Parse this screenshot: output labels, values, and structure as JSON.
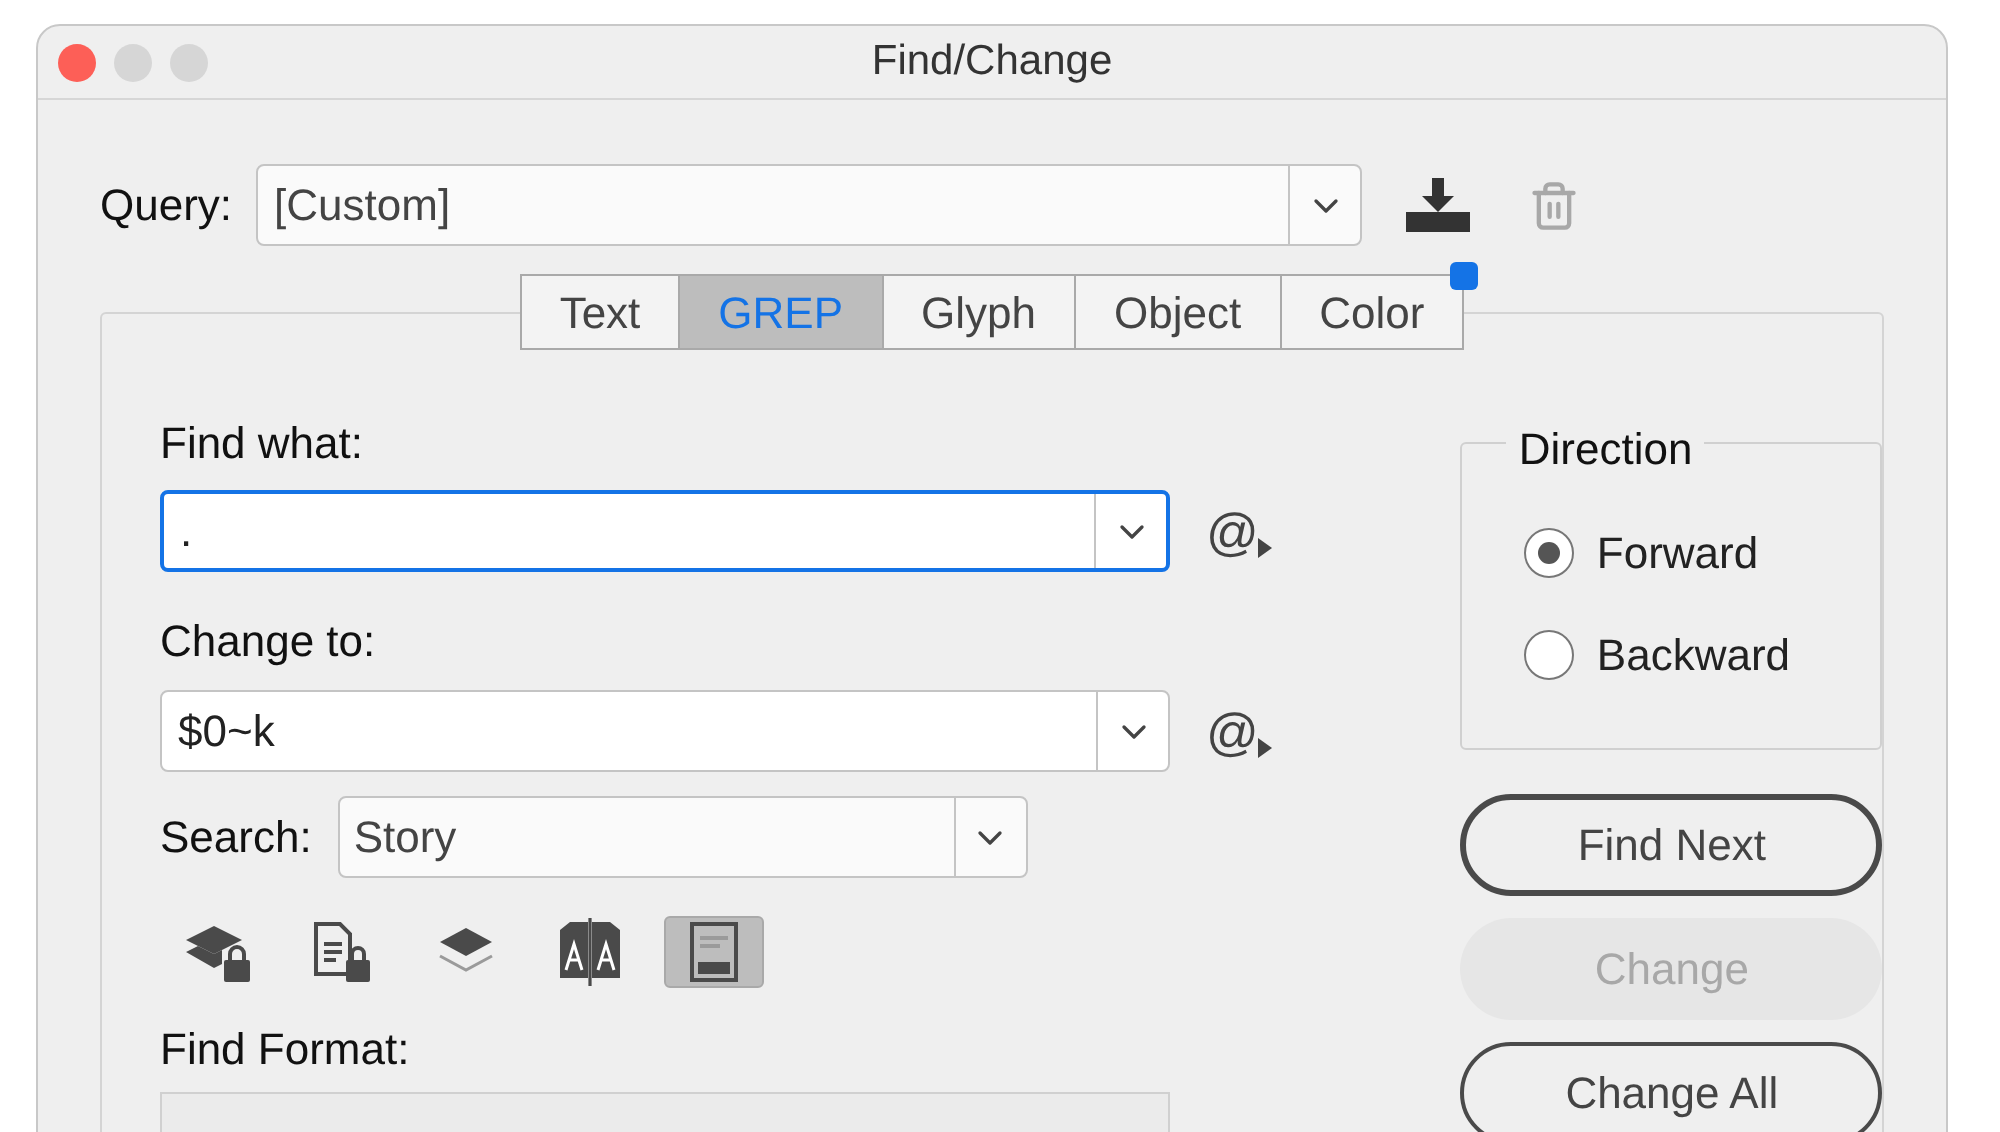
{
  "window": {
    "title": "Find/Change"
  },
  "query": {
    "label": "Query:",
    "value": "[Custom]"
  },
  "tabs": [
    {
      "label": "Text",
      "selected": false,
      "marked": false
    },
    {
      "label": "GREP",
      "selected": true,
      "marked": false
    },
    {
      "label": "Glyph",
      "selected": false,
      "marked": false
    },
    {
      "label": "Object",
      "selected": false,
      "marked": false
    },
    {
      "label": "Color",
      "selected": false,
      "marked": true
    }
  ],
  "find_what": {
    "label": "Find what:",
    "value": ".",
    "focused": true,
    "symbol_menu": "@"
  },
  "change_to": {
    "label": "Change to:",
    "value": "$0~k",
    "focused": false,
    "symbol_menu": "@"
  },
  "search": {
    "label": "Search:",
    "value": "Story"
  },
  "options": [
    {
      "kind": "locked-layers",
      "selected": false
    },
    {
      "kind": "locked-stories",
      "selected": false
    },
    {
      "kind": "hidden-layers",
      "selected": false
    },
    {
      "kind": "master-pages",
      "selected": false
    },
    {
      "kind": "footnotes",
      "selected": true
    }
  ],
  "find_format": {
    "label": "Find Format:"
  },
  "direction": {
    "title": "Direction",
    "options": [
      {
        "label": "Forward",
        "selected": true
      },
      {
        "label": "Backward",
        "selected": false
      }
    ]
  },
  "buttons": [
    {
      "label": "Find Next",
      "kind": "default",
      "disabled": false
    },
    {
      "label": "Change",
      "kind": "normal",
      "disabled": true
    },
    {
      "label": "Change All",
      "kind": "normal",
      "disabled": false
    }
  ]
}
